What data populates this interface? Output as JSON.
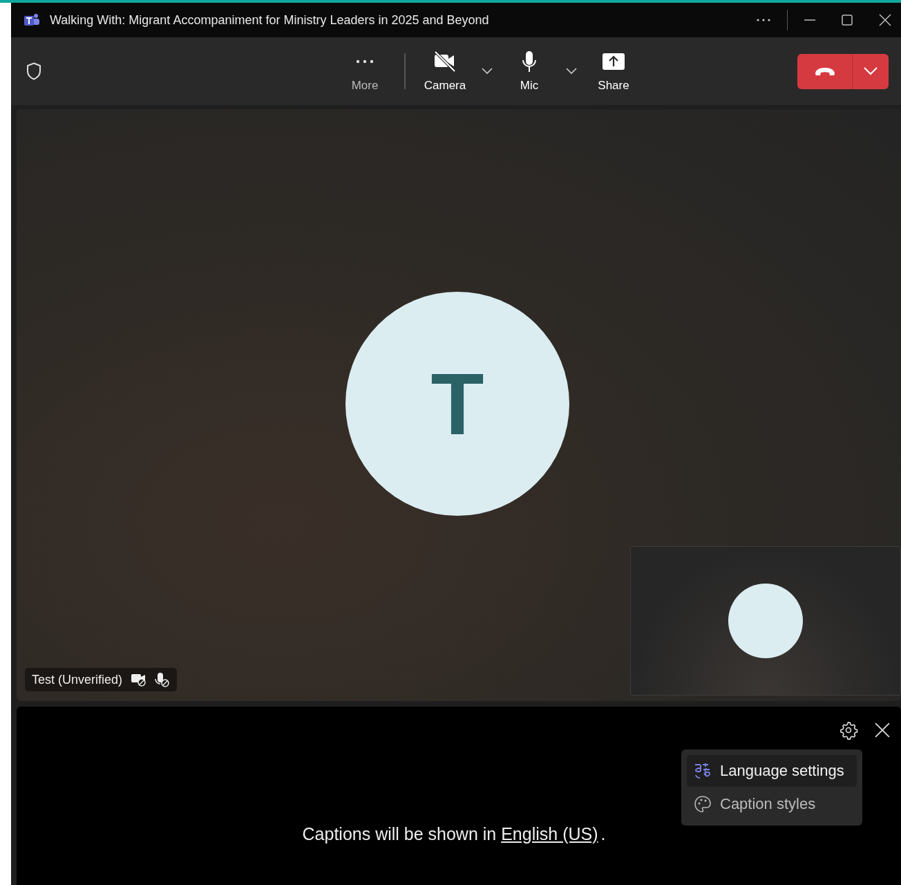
{
  "window": {
    "title": "Walking With: Migrant Accompaniment for Ministry Leaders in 2025 and Beyond"
  },
  "toolbar": {
    "buttons": [
      {
        "kind": "more",
        "label": "More"
      },
      {
        "kind": "camera",
        "label": "Camera",
        "off": true,
        "dropdown": true
      },
      {
        "kind": "mic",
        "label": "Mic",
        "off": false,
        "dropdown": true
      },
      {
        "kind": "share",
        "label": "Share"
      }
    ]
  },
  "stage": {
    "participant": {
      "initial": "T",
      "name": "Test (Unverified)",
      "camera_off": true,
      "mic_off": true
    }
  },
  "captions": {
    "notice": "Captions will be shown in",
    "language_link": "English (US)",
    "notice_end": ".",
    "menu": [
      {
        "kind": "language",
        "label": "Language settings",
        "selected": true
      },
      {
        "kind": "style",
        "label": "Caption styles",
        "selected": false
      }
    ]
  }
}
